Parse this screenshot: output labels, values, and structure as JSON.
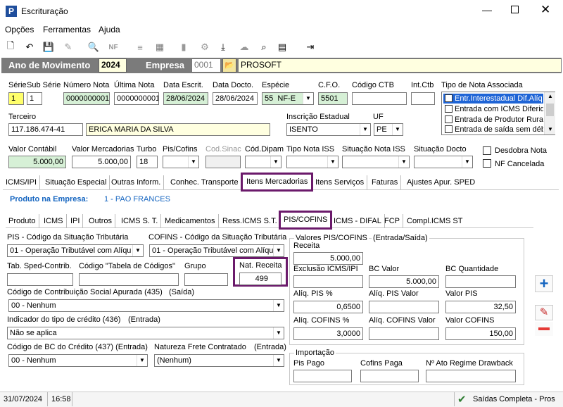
{
  "window": {
    "title": "Escrituração",
    "app_icon": "P"
  },
  "menu": [
    "Opções",
    "Ferramentas",
    "Ajuda"
  ],
  "header": {
    "ano_label": "Ano de Movimento",
    "ano_value": "2024",
    "empresa_label": "Empresa",
    "empresa_code": "0001",
    "empresa_name": "PROSOFT"
  },
  "labels": {
    "serie": "Série",
    "subserie": "Sub Série",
    "numero": "Número Nota",
    "ultima": "Última Nota",
    "data_escrit": "Data Escrit.",
    "data_docto": "Data Docto.",
    "especie": "Espécie",
    "cfo": "C.F.O.",
    "cod_ctb": "Código CTB",
    "int_ctb": "Int.Ctb",
    "tipo_nota": "Tipo de Nota Associada",
    "terceiro": "Terceiro",
    "insc_estadual": "Inscrição Estadual",
    "uf": "UF",
    "valor_contabil": "Valor Contábil",
    "valor_merc": "Valor Mercadorias",
    "turbo": "Turbo",
    "pis_cofins": "Pis/Cofins",
    "cod_sinac": "Cod.Sinac",
    "cod_dipam": "Cód.Dipam",
    "tipo_iss": "Tipo Nota ISS",
    "sit_iss": "Situação Nota ISS",
    "sit_docto": "Situação Docto",
    "desdobra": "Desdobra Nota",
    "nf_cancelada": "NF Cancelada"
  },
  "values": {
    "serie": "1",
    "subserie": "1",
    "numero": "0000000001",
    "ultima": "0000000001",
    "data_escrit": "28/06/2024",
    "data_docto": "28/06/2024",
    "especie_code": "55",
    "especie": "NF-E",
    "cfo": "5501",
    "terceiro_doc": "117.186.474-41",
    "terceiro_nome": "ERICA MARIA DA SILVA",
    "insc_estadual": "ISENTO",
    "uf": "PE",
    "valor_contabil": "5.000,00",
    "valor_merc": "5.000,00",
    "turbo": "18"
  },
  "tipo_nota_list": [
    "Entr.Interestadual Dif.Alíq",
    "Entrada com ICMS Diferido",
    "Entrada de Produtor Rural",
    "Entrada de saída sem débi"
  ],
  "main_tabs": [
    "ICMS/IPI",
    "Situação Especial",
    "Outras Inform.",
    "Conhec. Transporte",
    "Itens Mercadorias",
    "Itens Serviços",
    "Faturas",
    "Ajustes Apur. SPED"
  ],
  "produto": {
    "label": "Produto na Empresa:",
    "value": "1 - PAO FRANCES"
  },
  "sub_tabs": [
    "Produto",
    "ICMS",
    "IPI",
    "Outros",
    "ICMS S. T.",
    "Medicamentos",
    "Ress.ICMS S.T.",
    "PIS/COFINS",
    "ICMS - DIFAL",
    "FCP",
    "Compl.ICMS ST"
  ],
  "pis": {
    "pis_cst_label": "PIS - Código da Situação Tributária",
    "pis_cst": "01 - Operação Tributável com Alíqu",
    "cofins_cst_label": "COFINS - Código da Situação Tributária",
    "cofins_cst": "01 - Operação Tributável com Alíqu",
    "tab_sped_label": "Tab. Sped-Contrib.",
    "tab_codigos_label": "Código \"Tabela de Códigos\"",
    "grupo_label": "Grupo",
    "nat_receita_label": "Nat. Receita",
    "nat_receita": "499",
    "cod_contrib_label": "Código de Contribuição Social Apurada (435)",
    "cod_contrib_suffix": "(Saída)",
    "cod_contrib": "00 - Nenhum",
    "ind_credito_label": "Indicador do tipo de crédito (436)",
    "ind_credito_suffix": "(Entrada)",
    "ind_credito": "Não se aplica",
    "cod_bc_label": "Código de BC do Crédito (437) (Entrada)",
    "cod_bc": "00 - Nenhum",
    "nat_frete_label": "Natureza Frete Contratado",
    "nat_frete_suffix": "(Entrada)",
    "nat_frete": "(Nenhum)"
  },
  "valores": {
    "title": "Valores PIS/COFINS",
    "suffix": "(Entrada/Saída)",
    "receita_label": "Receita",
    "receita": "5.000,00",
    "exclusao_label": "Exclusão ICMS/IPI",
    "bc_valor_label": "BC Valor",
    "bc_valor": "5.000,00",
    "bc_qtd_label": "BC Quantidade",
    "aliq_pis_label": "Alíq. PIS %",
    "aliq_pis": "0,6500",
    "aliq_pis_valor_label": "Alíq. PIS Valor",
    "valor_pis_label": "Valor PIS",
    "valor_pis": "32,50",
    "aliq_cofins_label": "Alíq. COFINS %",
    "aliq_cofins": "3,0000",
    "aliq_cofins_valor_label": "Alíq. COFINS Valor",
    "valor_cofins_label": "Valor COFINS",
    "valor_cofins": "150,00"
  },
  "importacao": {
    "title": "Importação",
    "pis_pago": "Pis Pago",
    "cofins_paga": "Cofins Paga",
    "n_ato": "Nº Ato Regime Drawback"
  },
  "status": {
    "date": "31/07/2024",
    "time": "16:58",
    "message": "Saídas Completa - Pros"
  },
  "colors": {
    "header_bg": "#7b7b7b",
    "highlight": "#6b1a6b",
    "produto_blue": "#1565c0"
  }
}
